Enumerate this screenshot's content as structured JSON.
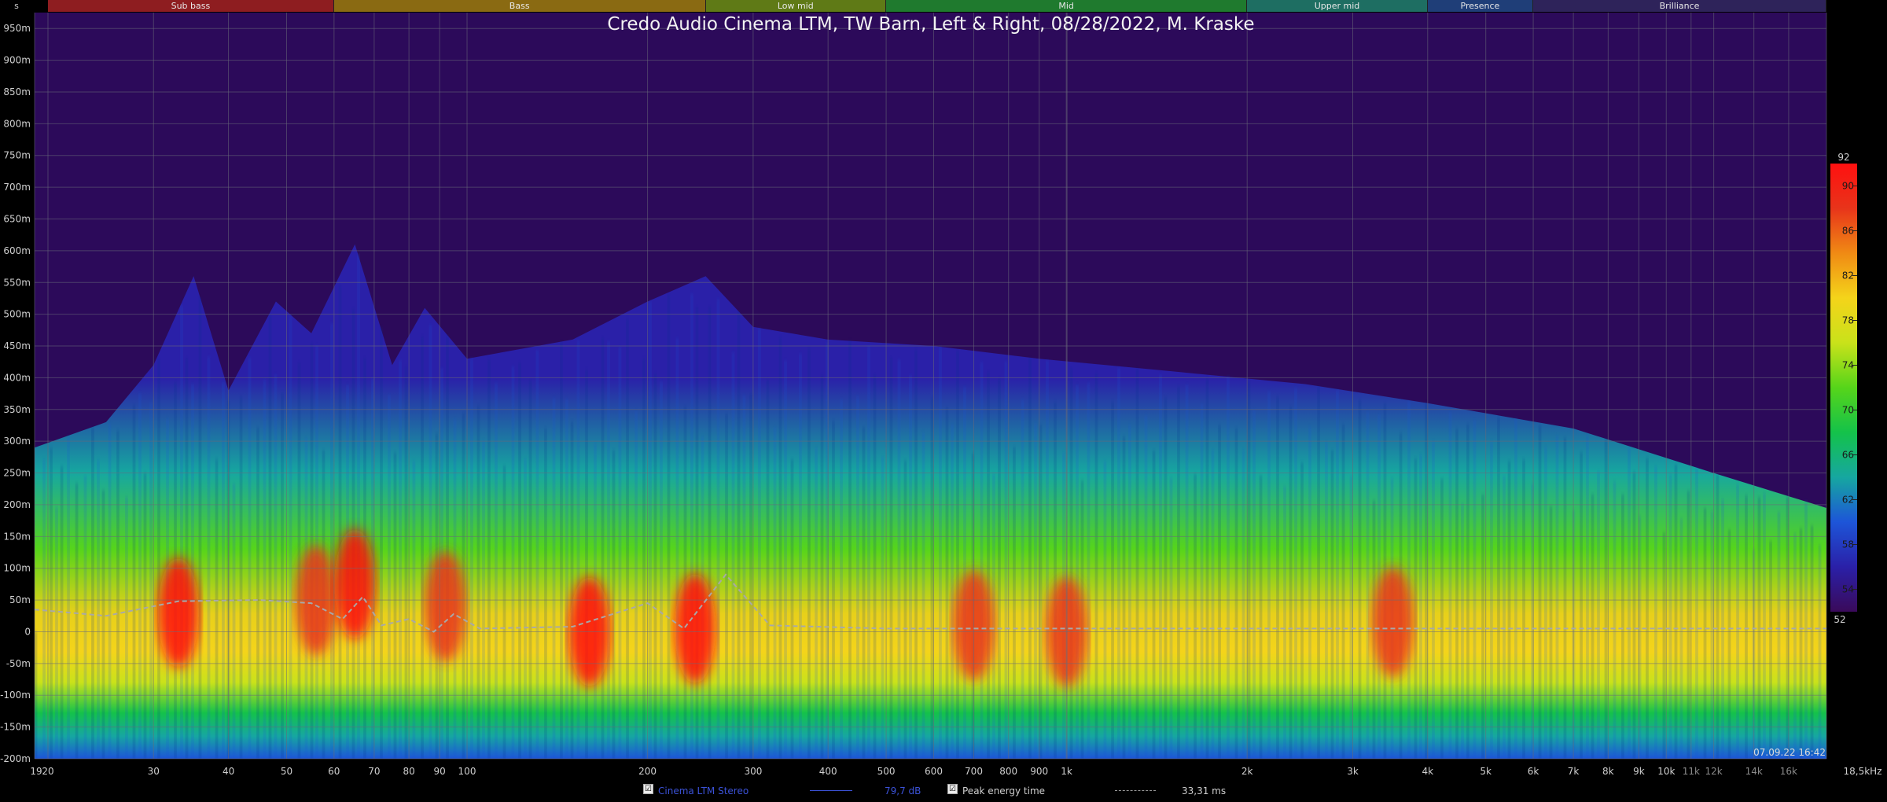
{
  "title": "Credo Audio Cinema LTM, TW Barn, Left & Right, 08/28/2022, M. Kraske",
  "timestamp": "07.09.22 16:42",
  "y_unit_label": "s",
  "frequency_bands": [
    {
      "label": "Sub bass",
      "color": "#8e1d20",
      "from": 20,
      "to": 60
    },
    {
      "label": "Bass",
      "color": "#8a6a12",
      "from": 60,
      "to": 250
    },
    {
      "label": "Low mid",
      "color": "#5f7a16",
      "from": 250,
      "to": 500
    },
    {
      "label": "Mid",
      "color": "#1f7a2e",
      "from": 500,
      "to": 2000
    },
    {
      "label": "Upper mid",
      "color": "#1e6e62",
      "from": 2000,
      "to": 4000
    },
    {
      "label": "Presence",
      "color": "#1f3e78",
      "from": 4000,
      "to": 6000
    },
    {
      "label": "Brilliance",
      "color": "#2e235a",
      "from": 6000,
      "to": 18500
    }
  ],
  "legend": {
    "series_name": "Cinema LTM Stereo",
    "series_value": "79,7 dB",
    "series_color": "#3b52d8",
    "peak_label": "Peak energy time",
    "peak_value": "33,31 ms",
    "checkmark": "☑"
  },
  "chart_data": {
    "type": "heatmap",
    "title": "Credo Audio Cinema LTM, TW Barn, Left & Right, 08/28/2022, M. Kraske",
    "x_scale": "log",
    "xlim": [
      19,
      18500
    ],
    "ylim": [
      -200,
      975
    ],
    "y_unit": "ms",
    "x_ticks": [
      {
        "v": 19,
        "label": "19"
      },
      {
        "v": 20,
        "label": "20"
      },
      {
        "v": 30,
        "label": "30"
      },
      {
        "v": 40,
        "label": "40"
      },
      {
        "v": 50,
        "label": "50"
      },
      {
        "v": 60,
        "label": "60"
      },
      {
        "v": 70,
        "label": "70"
      },
      {
        "v": 80,
        "label": "80"
      },
      {
        "v": 90,
        "label": "90"
      },
      {
        "v": 100,
        "label": "100"
      },
      {
        "v": 200,
        "label": "200"
      },
      {
        "v": 300,
        "label": "300"
      },
      {
        "v": 400,
        "label": "400"
      },
      {
        "v": 500,
        "label": "500"
      },
      {
        "v": 600,
        "label": "600"
      },
      {
        "v": 700,
        "label": "700"
      },
      {
        "v": 800,
        "label": "800"
      },
      {
        "v": 900,
        "label": "900"
      },
      {
        "v": 1000,
        "label": "1k"
      },
      {
        "v": 2000,
        "label": "2k"
      },
      {
        "v": 3000,
        "label": "3k"
      },
      {
        "v": 4000,
        "label": "4k"
      },
      {
        "v": 5000,
        "label": "5k"
      },
      {
        "v": 6000,
        "label": "6k"
      },
      {
        "v": 7000,
        "label": "7k"
      },
      {
        "v": 8000,
        "label": "8k"
      },
      {
        "v": 9000,
        "label": "9k"
      },
      {
        "v": 10000,
        "label": "10k"
      },
      {
        "v": 11000,
        "label": "11k"
      },
      {
        "v": 12000,
        "label": "12k"
      },
      {
        "v": 14000,
        "label": "14k"
      },
      {
        "v": 16000,
        "label": "16k"
      },
      {
        "v": 18500,
        "label": "18,5kHz"
      }
    ],
    "dim_x_ticks": [
      "11k",
      "12k",
      "14k",
      "16k"
    ],
    "y_ticks": [
      {
        "v": 950,
        "label": "950m"
      },
      {
        "v": 900,
        "label": "900m"
      },
      {
        "v": 850,
        "label": "850m"
      },
      {
        "v": 800,
        "label": "800m"
      },
      {
        "v": 750,
        "label": "750m"
      },
      {
        "v": 700,
        "label": "700m"
      },
      {
        "v": 650,
        "label": "650m"
      },
      {
        "v": 600,
        "label": "600m"
      },
      {
        "v": 550,
        "label": "550m"
      },
      {
        "v": 500,
        "label": "500m"
      },
      {
        "v": 450,
        "label": "450m"
      },
      {
        "v": 400,
        "label": "400m"
      },
      {
        "v": 350,
        "label": "350m"
      },
      {
        "v": 300,
        "label": "300m"
      },
      {
        "v": 250,
        "label": "250m"
      },
      {
        "v": 200,
        "label": "200m"
      },
      {
        "v": 150,
        "label": "150m"
      },
      {
        "v": 100,
        "label": "100m"
      },
      {
        "v": 50,
        "label": "50m"
      },
      {
        "v": 0,
        "label": "0"
      },
      {
        "v": -50,
        "label": "-50m"
      },
      {
        "v": -100,
        "label": "-100m"
      },
      {
        "v": -150,
        "label": "-150m"
      },
      {
        "v": -200,
        "label": "-200m"
      }
    ],
    "color_scale": {
      "min": 52,
      "max": 92,
      "ticks": [
        {
          "v": 90,
          "label": "90"
        },
        {
          "v": 86,
          "label": "86"
        },
        {
          "v": 82,
          "label": "82"
        },
        {
          "v": 78,
          "label": "78"
        },
        {
          "v": 74,
          "label": "74"
        },
        {
          "v": 70,
          "label": "70"
        },
        {
          "v": 66,
          "label": "66"
        },
        {
          "v": 62,
          "label": "62"
        },
        {
          "v": 58,
          "label": "58"
        },
        {
          "v": 54,
          "label": "54"
        }
      ],
      "max_label": "92",
      "min_label": "52",
      "colors": [
        "#3a0a5a",
        "#2a20a8",
        "#1d55d8",
        "#16a7a0",
        "#14c24a",
        "#56d51a",
        "#c9e21a",
        "#f4d41a",
        "#f08a14",
        "#e8341a",
        "#ff1010"
      ]
    },
    "envelope_top_ms": [
      {
        "f": 19,
        "t": 290
      },
      {
        "f": 25,
        "t": 330
      },
      {
        "f": 30,
        "t": 420
      },
      {
        "f": 35,
        "t": 560
      },
      {
        "f": 40,
        "t": 380
      },
      {
        "f": 48,
        "t": 520
      },
      {
        "f": 55,
        "t": 470
      },
      {
        "f": 65,
        "t": 610
      },
      {
        "f": 75,
        "t": 420
      },
      {
        "f": 85,
        "t": 510
      },
      {
        "f": 100,
        "t": 430
      },
      {
        "f": 150,
        "t": 460
      },
      {
        "f": 200,
        "t": 520
      },
      {
        "f": 250,
        "t": 560
      },
      {
        "f": 300,
        "t": 480
      },
      {
        "f": 400,
        "t": 460
      },
      {
        "f": 600,
        "t": 450
      },
      {
        "f": 900,
        "t": 430
      },
      {
        "f": 1500,
        "t": 410
      },
      {
        "f": 2500,
        "t": 390
      },
      {
        "f": 4000,
        "t": 360
      },
      {
        "f": 7000,
        "t": 320
      },
      {
        "f": 12000,
        "t": 250
      },
      {
        "f": 18500,
        "t": 195
      }
    ],
    "peak_energy_time_ms": [
      {
        "f": 19,
        "t": 35
      },
      {
        "f": 25,
        "t": 25
      },
      {
        "f": 33,
        "t": 48
      },
      {
        "f": 45,
        "t": 50
      },
      {
        "f": 55,
        "t": 45
      },
      {
        "f": 62,
        "t": 20
      },
      {
        "f": 67,
        "t": 55
      },
      {
        "f": 72,
        "t": 10
      },
      {
        "f": 80,
        "t": 20
      },
      {
        "f": 88,
        "t": 0
      },
      {
        "f": 95,
        "t": 28
      },
      {
        "f": 105,
        "t": 5
      },
      {
        "f": 150,
        "t": 8
      },
      {
        "f": 200,
        "t": 45
      },
      {
        "f": 230,
        "t": 5
      },
      {
        "f": 270,
        "t": 90
      },
      {
        "f": 320,
        "t": 10
      },
      {
        "f": 500,
        "t": 5
      },
      {
        "f": 1000,
        "t": 5
      },
      {
        "f": 18500,
        "t": 5
      }
    ],
    "hotspots": [
      {
        "f": 33,
        "t": 30,
        "level": 90
      },
      {
        "f": 56,
        "t": 50,
        "level": 88
      },
      {
        "f": 65,
        "t": 75,
        "level": 90
      },
      {
        "f": 92,
        "t": 40,
        "level": 86
      },
      {
        "f": 160,
        "t": 0,
        "level": 92
      },
      {
        "f": 240,
        "t": 5,
        "level": 91
      },
      {
        "f": 700,
        "t": 10,
        "level": 88
      },
      {
        "f": 1000,
        "t": 0,
        "level": 86
      },
      {
        "f": 3500,
        "t": 15,
        "level": 86
      }
    ]
  }
}
